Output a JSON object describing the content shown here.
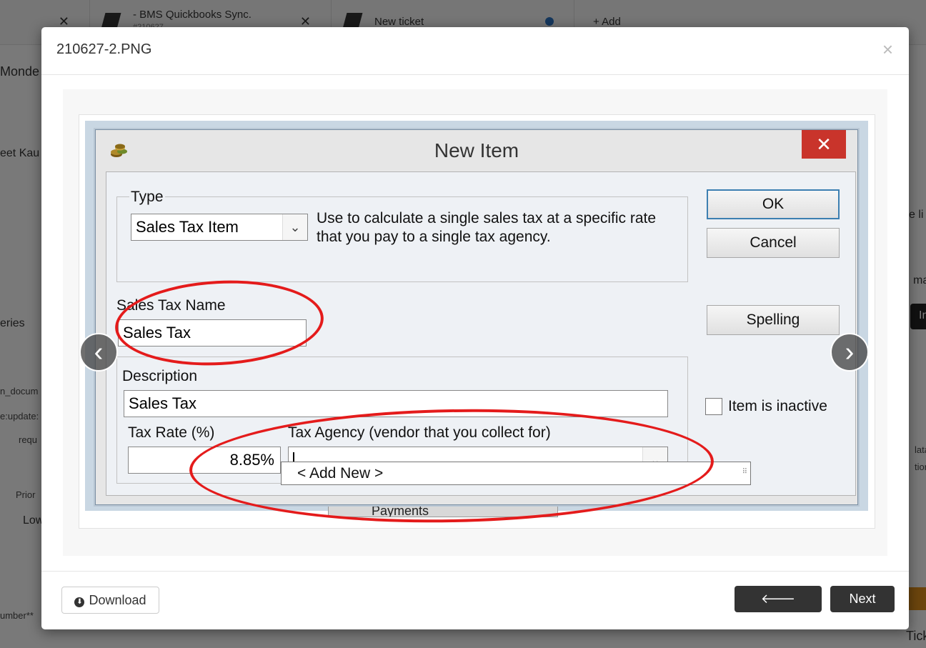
{
  "background": {
    "tabs": [
      {
        "title": "",
        "subtitle": ""
      },
      {
        "title": "- BMS Quickbooks Sync.",
        "subtitle": "#210627"
      },
      {
        "title": "New ticket",
        "subtitle": ""
      },
      {
        "title": "+ Add",
        "subtitle": ""
      }
    ],
    "fragments": [
      "Monde",
      "eet Kau",
      "eries",
      "n_docum",
      "e:update:",
      "requ",
      "Prior",
      "Low",
      "umber**",
      "e li",
      "ma",
      "In",
      "lata",
      "tion",
      "Tick"
    ]
  },
  "modal": {
    "title": "210627-2.PNG",
    "close": "×",
    "footer": {
      "download_label": "Download",
      "previous_label": "Previous",
      "next_label": "Next"
    },
    "nav": {
      "prev_glyph": "‹",
      "next_glyph": "›"
    }
  },
  "screenshot": {
    "window_title": "New Item",
    "close_glyph": "✕",
    "type": {
      "label": "Type",
      "value": "Sales Tax Item",
      "description_line1": "Use to calculate a single sales tax at a specific rate",
      "description_line2": "that you pay to a single tax agency."
    },
    "sales_tax_name": {
      "label": "Sales Tax Name",
      "value": "Sales Tax"
    },
    "description": {
      "label": "Description",
      "value": "Sales Tax"
    },
    "tax_rate": {
      "label": "Tax Rate (%)",
      "value": "8.85%"
    },
    "tax_agency": {
      "label": "Tax Agency (vendor that you collect for)",
      "value": "",
      "dropdown_item": "< Add New >"
    },
    "buttons": {
      "ok": "OK",
      "cancel": "Cancel",
      "spelling": "Spelling"
    },
    "inactive_label": "Item is inactive",
    "behind_text": "Payments",
    "annotation_color": "#e41b1b"
  }
}
